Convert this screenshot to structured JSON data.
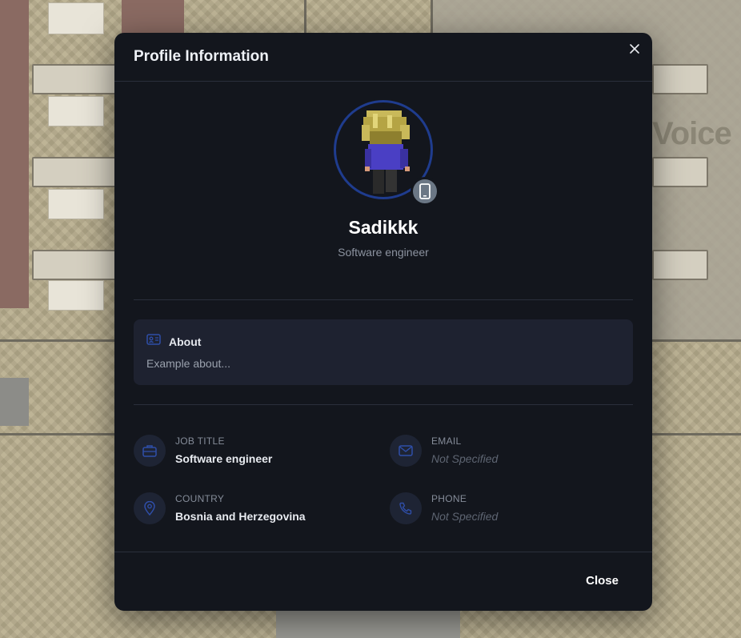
{
  "background": {
    "map_label": "Voice"
  },
  "modal": {
    "title": "Profile Information",
    "close_icon": "close-icon",
    "footer": {
      "close_label": "Close"
    }
  },
  "profile": {
    "name": "Sadikkk",
    "subtitle": "Software engineer",
    "avatar_ring_color": "#1f3c8e",
    "device_icon": "mobile-phone-icon"
  },
  "about": {
    "title": "About",
    "text": "Example about...",
    "icon": "id-card-icon"
  },
  "info": {
    "job_title": {
      "label": "JOB TITLE",
      "value": "Software engineer",
      "icon": "briefcase-icon"
    },
    "email": {
      "label": "EMAIL",
      "value": "Not Specified",
      "icon": "mail-icon"
    },
    "country": {
      "label": "COUNTRY",
      "value": "Bosnia and Herzegovina",
      "icon": "location-pin-icon"
    },
    "phone": {
      "label": "PHONE",
      "value": "Not Specified",
      "icon": "phone-icon"
    }
  },
  "colors": {
    "modal_bg": "#13161d",
    "accent_blue": "#2b4a9e",
    "card_bg": "#1e2230"
  }
}
